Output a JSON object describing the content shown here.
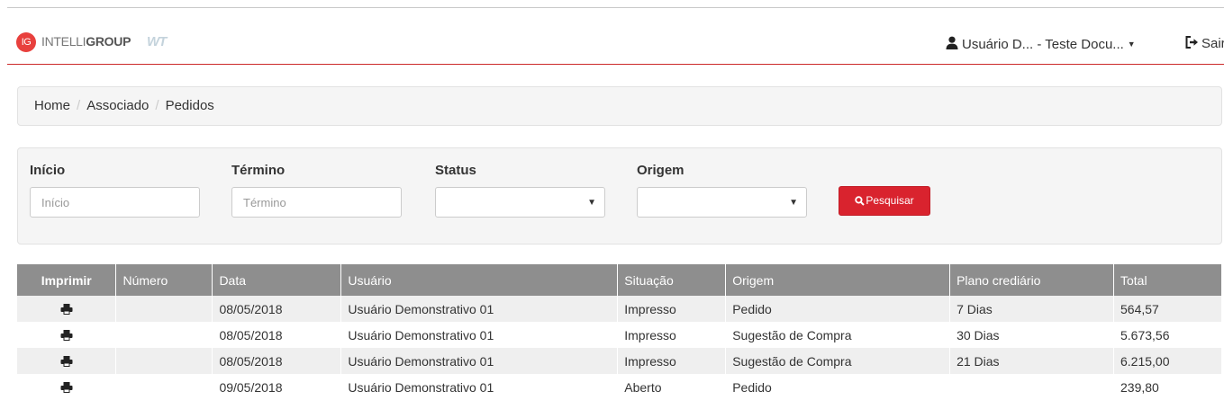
{
  "app": {
    "logo_badge": "IG",
    "logo_light": "INTELLI",
    "logo_bold": "GROUP",
    "logo_mark": "WT",
    "brand_color": "#d9232e"
  },
  "header": {
    "user_label": "Usuário D... - Teste Docu...",
    "logout_label": "Sair"
  },
  "breadcrumb": {
    "items": [
      "Home",
      "Associado",
      "Pedidos"
    ],
    "separator": "/"
  },
  "filters": {
    "inicio": {
      "label": "Início",
      "placeholder": "Início",
      "value": ""
    },
    "termino": {
      "label": "Término",
      "placeholder": "Término",
      "value": ""
    },
    "status": {
      "label": "Status",
      "value": ""
    },
    "origem": {
      "label": "Origem",
      "value": ""
    },
    "search_button": "Pesquisar"
  },
  "table": {
    "columns": [
      "Imprimir",
      "Número",
      "Data",
      "Usuário",
      "Situação",
      "Origem",
      "Plano crediário",
      "Total"
    ],
    "rows": [
      {
        "numero": "",
        "data": "08/05/2018",
        "usuario": "Usuário Demonstrativo 01",
        "situacao": "Impresso",
        "origem": "Pedido",
        "plano": "7 Dias",
        "total": "564,57"
      },
      {
        "numero": "",
        "data": "08/05/2018",
        "usuario": "Usuário Demonstrativo 01",
        "situacao": "Impresso",
        "origem": "Sugestão de Compra",
        "plano": "30 Dias",
        "total": "5.673,56"
      },
      {
        "numero": "",
        "data": "08/05/2018",
        "usuario": "Usuário Demonstrativo 01",
        "situacao": "Impresso",
        "origem": "Sugestão de Compra",
        "plano": "21 Dias",
        "total": "6.215,00"
      },
      {
        "numero": "",
        "data": "09/05/2018",
        "usuario": "Usuário Demonstrativo 01",
        "situacao": "Aberto",
        "origem": "Pedido",
        "plano": "",
        "total": "239,80"
      }
    ]
  }
}
